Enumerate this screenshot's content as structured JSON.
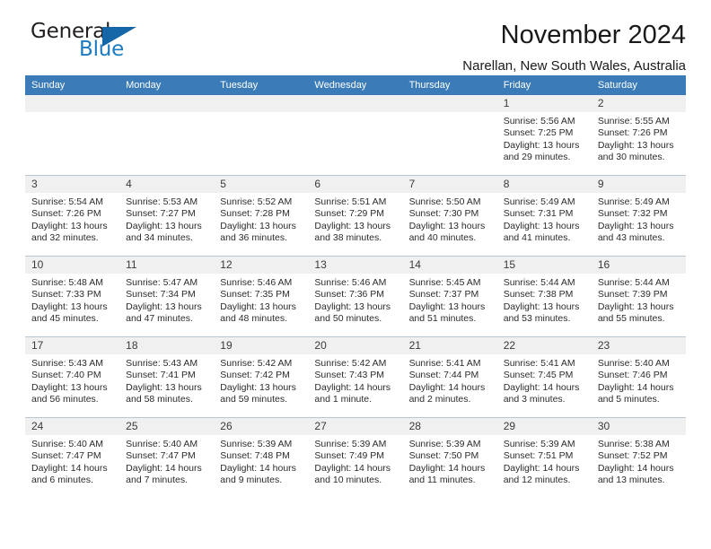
{
  "logo": {
    "line1": "General",
    "line2": "Blue",
    "triangle_color": "#1667a8",
    "blue_color": "#1c7ac0"
  },
  "header": {
    "title": "November 2024",
    "subtitle": "Narellan, New South Wales, Australia"
  },
  "theme": {
    "header_blue": "#3b7cb8",
    "daynum_gray": "#f0f0f0",
    "grid_line": "#b9c6d4"
  },
  "weekdays": [
    "Sunday",
    "Monday",
    "Tuesday",
    "Wednesday",
    "Thursday",
    "Friday",
    "Saturday"
  ],
  "weeks": [
    [
      {
        "day": "",
        "sunrise": "",
        "sunset": "",
        "daylight1": "",
        "daylight2": ""
      },
      {
        "day": "",
        "sunrise": "",
        "sunset": "",
        "daylight1": "",
        "daylight2": ""
      },
      {
        "day": "",
        "sunrise": "",
        "sunset": "",
        "daylight1": "",
        "daylight2": ""
      },
      {
        "day": "",
        "sunrise": "",
        "sunset": "",
        "daylight1": "",
        "daylight2": ""
      },
      {
        "day": "",
        "sunrise": "",
        "sunset": "",
        "daylight1": "",
        "daylight2": ""
      },
      {
        "day": "1",
        "sunrise": "Sunrise: 5:56 AM",
        "sunset": "Sunset: 7:25 PM",
        "daylight1": "Daylight: 13 hours",
        "daylight2": "and 29 minutes."
      },
      {
        "day": "2",
        "sunrise": "Sunrise: 5:55 AM",
        "sunset": "Sunset: 7:26 PM",
        "daylight1": "Daylight: 13 hours",
        "daylight2": "and 30 minutes."
      }
    ],
    [
      {
        "day": "3",
        "sunrise": "Sunrise: 5:54 AM",
        "sunset": "Sunset: 7:26 PM",
        "daylight1": "Daylight: 13 hours",
        "daylight2": "and 32 minutes."
      },
      {
        "day": "4",
        "sunrise": "Sunrise: 5:53 AM",
        "sunset": "Sunset: 7:27 PM",
        "daylight1": "Daylight: 13 hours",
        "daylight2": "and 34 minutes."
      },
      {
        "day": "5",
        "sunrise": "Sunrise: 5:52 AM",
        "sunset": "Sunset: 7:28 PM",
        "daylight1": "Daylight: 13 hours",
        "daylight2": "and 36 minutes."
      },
      {
        "day": "6",
        "sunrise": "Sunrise: 5:51 AM",
        "sunset": "Sunset: 7:29 PM",
        "daylight1": "Daylight: 13 hours",
        "daylight2": "and 38 minutes."
      },
      {
        "day": "7",
        "sunrise": "Sunrise: 5:50 AM",
        "sunset": "Sunset: 7:30 PM",
        "daylight1": "Daylight: 13 hours",
        "daylight2": "and 40 minutes."
      },
      {
        "day": "8",
        "sunrise": "Sunrise: 5:49 AM",
        "sunset": "Sunset: 7:31 PM",
        "daylight1": "Daylight: 13 hours",
        "daylight2": "and 41 minutes."
      },
      {
        "day": "9",
        "sunrise": "Sunrise: 5:49 AM",
        "sunset": "Sunset: 7:32 PM",
        "daylight1": "Daylight: 13 hours",
        "daylight2": "and 43 minutes."
      }
    ],
    [
      {
        "day": "10",
        "sunrise": "Sunrise: 5:48 AM",
        "sunset": "Sunset: 7:33 PM",
        "daylight1": "Daylight: 13 hours",
        "daylight2": "and 45 minutes."
      },
      {
        "day": "11",
        "sunrise": "Sunrise: 5:47 AM",
        "sunset": "Sunset: 7:34 PM",
        "daylight1": "Daylight: 13 hours",
        "daylight2": "and 47 minutes."
      },
      {
        "day": "12",
        "sunrise": "Sunrise: 5:46 AM",
        "sunset": "Sunset: 7:35 PM",
        "daylight1": "Daylight: 13 hours",
        "daylight2": "and 48 minutes."
      },
      {
        "day": "13",
        "sunrise": "Sunrise: 5:46 AM",
        "sunset": "Sunset: 7:36 PM",
        "daylight1": "Daylight: 13 hours",
        "daylight2": "and 50 minutes."
      },
      {
        "day": "14",
        "sunrise": "Sunrise: 5:45 AM",
        "sunset": "Sunset: 7:37 PM",
        "daylight1": "Daylight: 13 hours",
        "daylight2": "and 51 minutes."
      },
      {
        "day": "15",
        "sunrise": "Sunrise: 5:44 AM",
        "sunset": "Sunset: 7:38 PM",
        "daylight1": "Daylight: 13 hours",
        "daylight2": "and 53 minutes."
      },
      {
        "day": "16",
        "sunrise": "Sunrise: 5:44 AM",
        "sunset": "Sunset: 7:39 PM",
        "daylight1": "Daylight: 13 hours",
        "daylight2": "and 55 minutes."
      }
    ],
    [
      {
        "day": "17",
        "sunrise": "Sunrise: 5:43 AM",
        "sunset": "Sunset: 7:40 PM",
        "daylight1": "Daylight: 13 hours",
        "daylight2": "and 56 minutes."
      },
      {
        "day": "18",
        "sunrise": "Sunrise: 5:43 AM",
        "sunset": "Sunset: 7:41 PM",
        "daylight1": "Daylight: 13 hours",
        "daylight2": "and 58 minutes."
      },
      {
        "day": "19",
        "sunrise": "Sunrise: 5:42 AM",
        "sunset": "Sunset: 7:42 PM",
        "daylight1": "Daylight: 13 hours",
        "daylight2": "and 59 minutes."
      },
      {
        "day": "20",
        "sunrise": "Sunrise: 5:42 AM",
        "sunset": "Sunset: 7:43 PM",
        "daylight1": "Daylight: 14 hours",
        "daylight2": "and 1 minute."
      },
      {
        "day": "21",
        "sunrise": "Sunrise: 5:41 AM",
        "sunset": "Sunset: 7:44 PM",
        "daylight1": "Daylight: 14 hours",
        "daylight2": "and 2 minutes."
      },
      {
        "day": "22",
        "sunrise": "Sunrise: 5:41 AM",
        "sunset": "Sunset: 7:45 PM",
        "daylight1": "Daylight: 14 hours",
        "daylight2": "and 3 minutes."
      },
      {
        "day": "23",
        "sunrise": "Sunrise: 5:40 AM",
        "sunset": "Sunset: 7:46 PM",
        "daylight1": "Daylight: 14 hours",
        "daylight2": "and 5 minutes."
      }
    ],
    [
      {
        "day": "24",
        "sunrise": "Sunrise: 5:40 AM",
        "sunset": "Sunset: 7:47 PM",
        "daylight1": "Daylight: 14 hours",
        "daylight2": "and 6 minutes."
      },
      {
        "day": "25",
        "sunrise": "Sunrise: 5:40 AM",
        "sunset": "Sunset: 7:47 PM",
        "daylight1": "Daylight: 14 hours",
        "daylight2": "and 7 minutes."
      },
      {
        "day": "26",
        "sunrise": "Sunrise: 5:39 AM",
        "sunset": "Sunset: 7:48 PM",
        "daylight1": "Daylight: 14 hours",
        "daylight2": "and 9 minutes."
      },
      {
        "day": "27",
        "sunrise": "Sunrise: 5:39 AM",
        "sunset": "Sunset: 7:49 PM",
        "daylight1": "Daylight: 14 hours",
        "daylight2": "and 10 minutes."
      },
      {
        "day": "28",
        "sunrise": "Sunrise: 5:39 AM",
        "sunset": "Sunset: 7:50 PM",
        "daylight1": "Daylight: 14 hours",
        "daylight2": "and 11 minutes."
      },
      {
        "day": "29",
        "sunrise": "Sunrise: 5:39 AM",
        "sunset": "Sunset: 7:51 PM",
        "daylight1": "Daylight: 14 hours",
        "daylight2": "and 12 minutes."
      },
      {
        "day": "30",
        "sunrise": "Sunrise: 5:38 AM",
        "sunset": "Sunset: 7:52 PM",
        "daylight1": "Daylight: 14 hours",
        "daylight2": "and 13 minutes."
      }
    ]
  ]
}
